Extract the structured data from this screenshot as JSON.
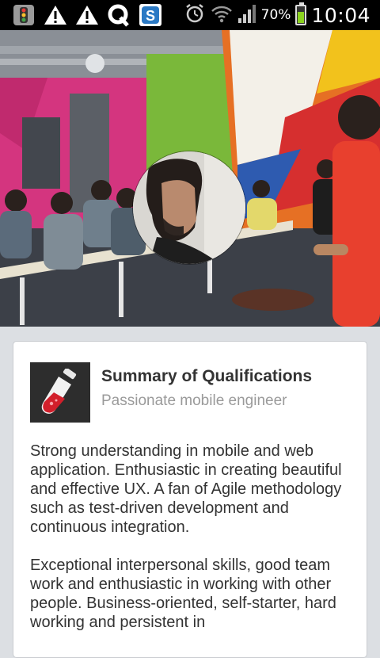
{
  "status_bar": {
    "notification_icons": [
      "traffic-light-icon",
      "warning-icon",
      "warning-icon",
      "q-icon",
      "skype-icon"
    ],
    "battery_percent": "70%",
    "battery_level": 0.7,
    "time": "10:04"
  },
  "hero": {
    "image": "classroom-presentation-photo",
    "avatar": "profile-photo"
  },
  "summary_card": {
    "title": "Summary of Qualifications",
    "subtitle": "Passionate mobile engineer",
    "icon": "test-tube-icon",
    "paragraphs": [
      "Strong understanding in mobile and web application. Enthusiastic in creating beautiful and effective UX. A fan of Agile methodology such as test-driven development and continuous integration.",
      "Exceptional interpersonal skills, good team work and enthusiastic in working with other people. Business-oriented, self-starter, hard working and persistent in"
    ]
  }
}
